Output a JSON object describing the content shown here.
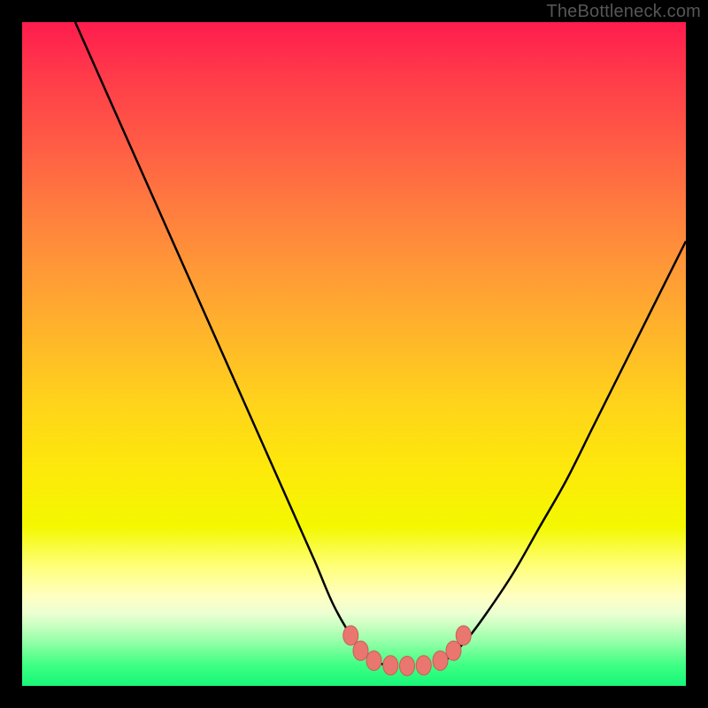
{
  "watermark": "TheBottleneck.com",
  "chart_data": {
    "type": "line",
    "title": "",
    "xlabel": "",
    "ylabel": "",
    "xlim": [
      0,
      100
    ],
    "ylim": [
      0,
      100
    ],
    "grid": false,
    "legend": false,
    "series": [
      {
        "name": "left-curve",
        "x": [
          8,
          12,
          16,
          20,
          24,
          28,
          32,
          36,
          40,
          44,
          47,
          50,
          53,
          55
        ],
        "y": [
          100,
          91,
          82,
          73,
          64,
          55,
          46,
          37,
          28,
          19,
          12,
          7,
          4,
          3
        ]
      },
      {
        "name": "right-curve",
        "x": [
          62,
          64,
          67,
          70,
          74,
          78,
          82,
          86,
          90,
          94,
          98,
          100
        ],
        "y": [
          3,
          4,
          7,
          11,
          17,
          24,
          31,
          39,
          47,
          55,
          63,
          67
        ]
      },
      {
        "name": "trough-markers",
        "x": [
          49.5,
          51,
          53,
          55.5,
          58,
          60.5,
          63,
          65,
          66.5
        ],
        "y": [
          7.6,
          5.3,
          3.8,
          3.1,
          3.0,
          3.1,
          3.8,
          5.3,
          7.6
        ]
      }
    ],
    "colors": {
      "curve_stroke": "#000000",
      "marker_fill": "#e9776f",
      "marker_stroke": "#c85f58",
      "gradient_top": "#ff1c4e",
      "gradient_mid": "#ffd51a",
      "gradient_bottom": "#17f77a",
      "frame": "#000000"
    }
  }
}
